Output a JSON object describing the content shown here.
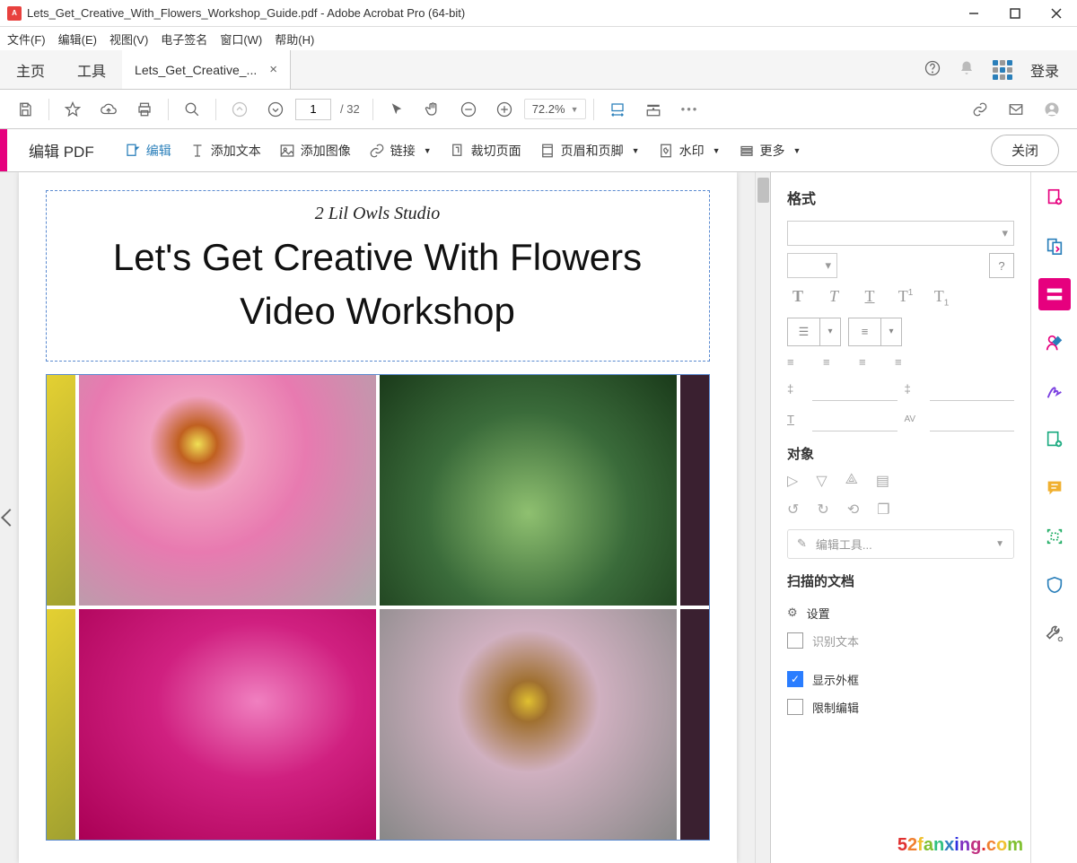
{
  "window": {
    "title": "Lets_Get_Creative_With_Flowers_Workshop_Guide.pdf - Adobe Acrobat Pro (64-bit)"
  },
  "menu": {
    "file": "文件(F)",
    "edit": "编辑(E)",
    "view": "视图(V)",
    "esign": "电子签名",
    "window": "窗口(W)",
    "help": "帮助(H)"
  },
  "tabs": {
    "home": "主页",
    "tools": "工具",
    "doc": "Lets_Get_Creative_...",
    "login": "登录"
  },
  "toolbar": {
    "page_current": "1",
    "page_total": "/ 32",
    "zoom": "72.2%"
  },
  "edit_bar": {
    "title": "编辑 PDF",
    "edit": "编辑",
    "add_text": "添加文本",
    "add_image": "添加图像",
    "link": "链接",
    "crop": "裁切页面",
    "header": "页眉和页脚",
    "watermark": "水印",
    "more": "更多",
    "close": "关闭"
  },
  "document": {
    "subtitle": "2 Lil Owls Studio",
    "title_line1": "Let's Get Creative With Flowers",
    "title_line2": "Video Workshop"
  },
  "format_panel": {
    "format": "格式",
    "object": "对象",
    "edit_tool": "编辑工具...",
    "scanned": "扫描的文档",
    "settings": "设置",
    "ocr": "识别文本",
    "show_box": "显示外框",
    "restrict": "限制编辑"
  },
  "watermark_text": "52fanxing.com"
}
